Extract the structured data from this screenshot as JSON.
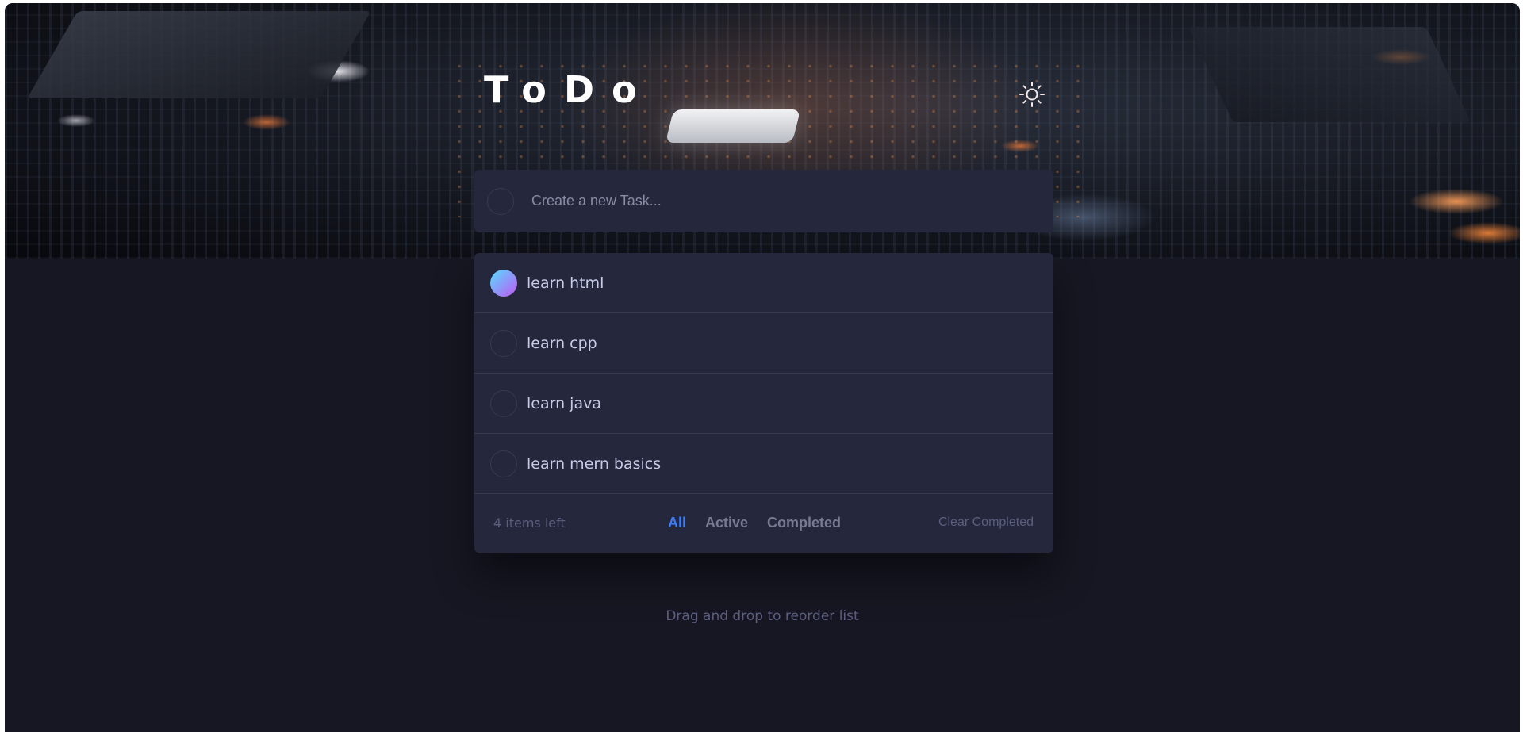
{
  "app": {
    "title": "ToDo",
    "theme_toggle_icon": "sun-icon"
  },
  "new_task": {
    "placeholder": "Create a new Task...",
    "value": ""
  },
  "todos": [
    {
      "text": "learn html",
      "completed": true
    },
    {
      "text": "learn cpp",
      "completed": false
    },
    {
      "text": "learn java",
      "completed": false
    },
    {
      "text": "learn mern basics",
      "completed": false
    }
  ],
  "footer": {
    "items_left": "4 items left",
    "filters": [
      "All",
      "Active",
      "Completed"
    ],
    "active_filter": "All",
    "clear_label": "Clear Completed"
  },
  "hint": "Drag and drop to reorder list",
  "colors": {
    "background": "#161722",
    "card": "#25273c",
    "accent": "#3a7cfd",
    "check_gradient_start": "#57ddff",
    "check_gradient_end": "#c058f3"
  }
}
